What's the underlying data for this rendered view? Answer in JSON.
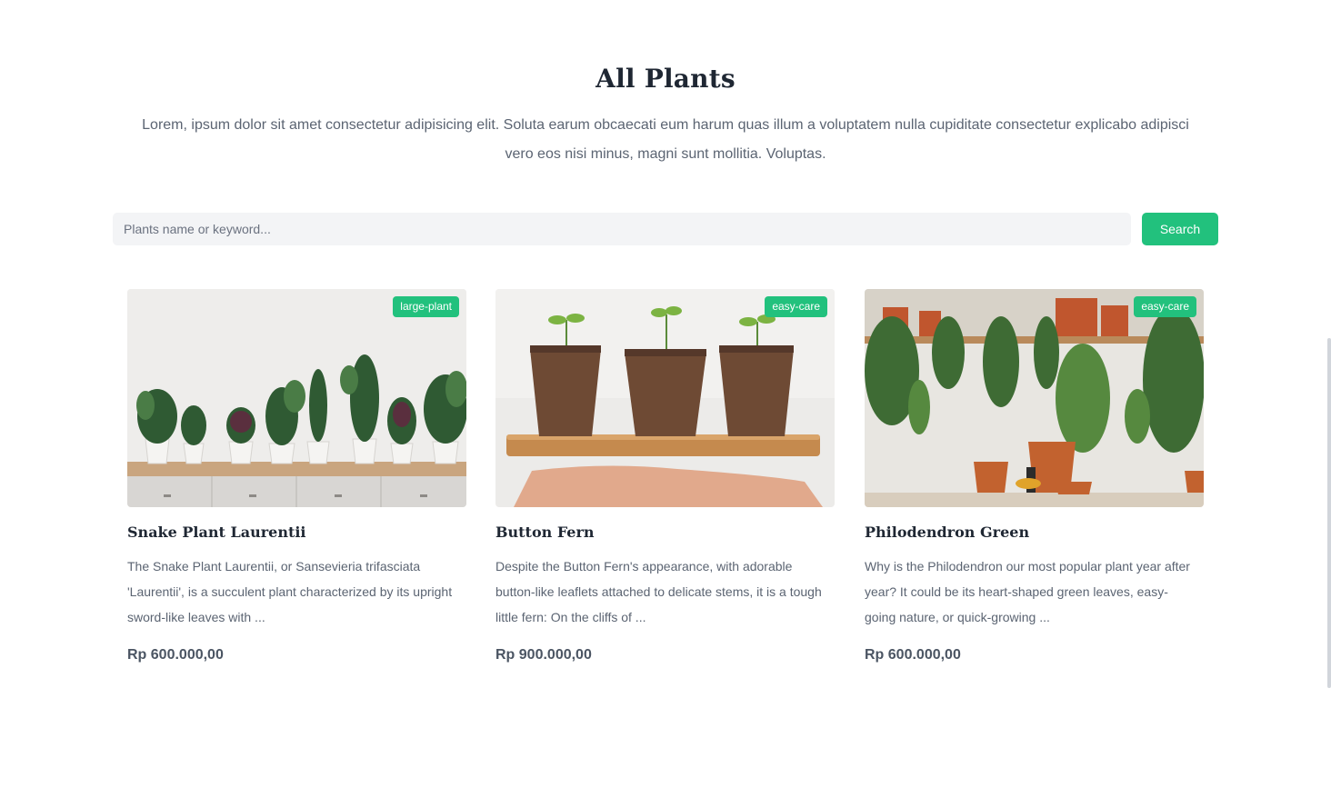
{
  "header": {
    "title": "All Plants",
    "subtitle": "Lorem, ipsum dolor sit amet consectetur adipisicing elit. Soluta earum obcaecati eum harum quas illum a voluptatem nulla cupiditate consectetur explicabo adipisci vero eos nisi minus, magni sunt mollitia. Voluptas."
  },
  "search": {
    "placeholder": "Plants name or keyword...",
    "value": "",
    "button_label": "Search"
  },
  "products": [
    {
      "tag": "large-plant",
      "name": "Snake Plant Laurentii",
      "description": "The Snake Plant Laurentii, or Sansevieria trifasciata 'Laurentii', is a succulent plant characterized by its upright sword-like leaves with ...",
      "price": "Rp 600.000,00"
    },
    {
      "tag": "easy-care",
      "name": "Button Fern",
      "description": "Despite the Button Fern's appearance, with adorable button-like leaflets attached to delicate stems, it is a tough little fern: On the cliffs of ...",
      "price": "Rp 900.000,00"
    },
    {
      "tag": "easy-care",
      "name": "Philodendron Green",
      "description": "Why is the Philodendron our most popular plant year after year? It could be its heart-shaped green leaves, easy-going nature, or quick-growing ...",
      "price": "Rp 600.000,00"
    }
  ],
  "colors": {
    "accent": "#22c17d",
    "title": "#1f2733",
    "body_text": "#5b6472"
  }
}
